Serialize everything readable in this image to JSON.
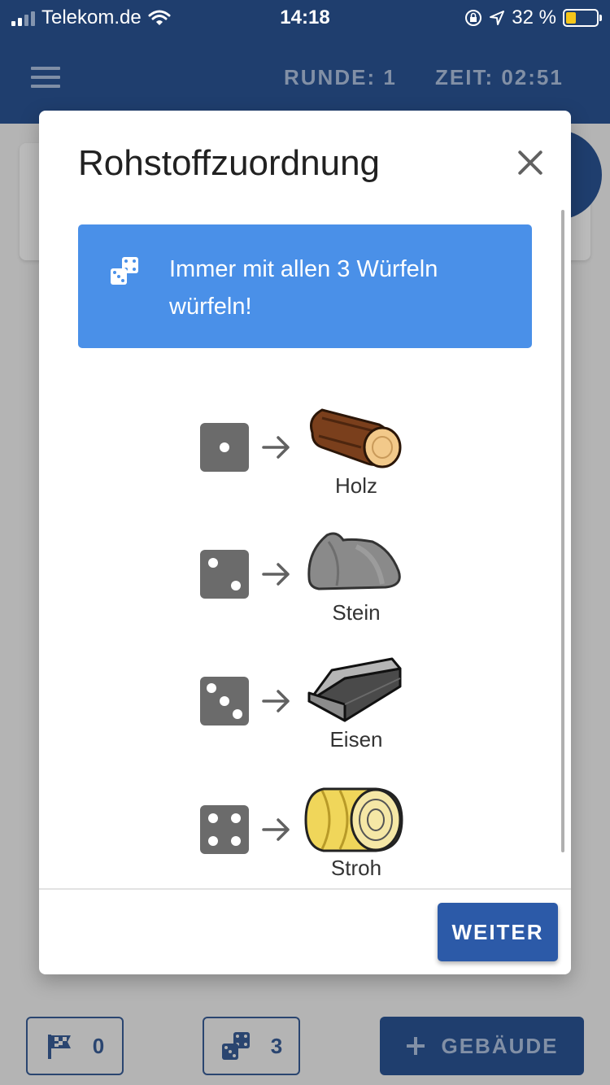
{
  "status_bar": {
    "carrier": "Telekom.de",
    "time": "14:18",
    "battery": "32 %",
    "battery_level": 0.32,
    "icons": [
      "signal-icon",
      "wifi-icon",
      "rotation-lock-icon",
      "location-icon",
      "battery-icon"
    ]
  },
  "header": {
    "menu_icon": "hamburger-menu-icon",
    "round": "RUNDE: 1",
    "time": "ZEIT: 02:51"
  },
  "dialog": {
    "title": "Rohstoffzuordnung",
    "close_icon": "close-icon",
    "info": {
      "icon": "dice-icon",
      "text": "Immer mit allen 3 Würfeln würfeln!"
    },
    "mappings": [
      {
        "die_value": 1,
        "resource": "Holz",
        "image": "wood-log"
      },
      {
        "die_value": 2,
        "resource": "Stein",
        "image": "stone"
      },
      {
        "die_value": 3,
        "resource": "Eisen",
        "image": "iron-ingot"
      },
      {
        "die_value": 4,
        "resource": "Stroh",
        "image": "straw-bale"
      }
    ],
    "continue_label": "WEITER"
  },
  "bottom_bar": {
    "flag_count": "0",
    "dice_count": "3",
    "build_label": "GEBÄUDE",
    "build_icon": "plus-icon"
  },
  "colors": {
    "header_bg": "#1f3e6e",
    "info_bg": "#4a90e8",
    "primary_button": "#2c5aa8",
    "die": "#6b6b6b",
    "battery_fill": "#f5c61a"
  }
}
